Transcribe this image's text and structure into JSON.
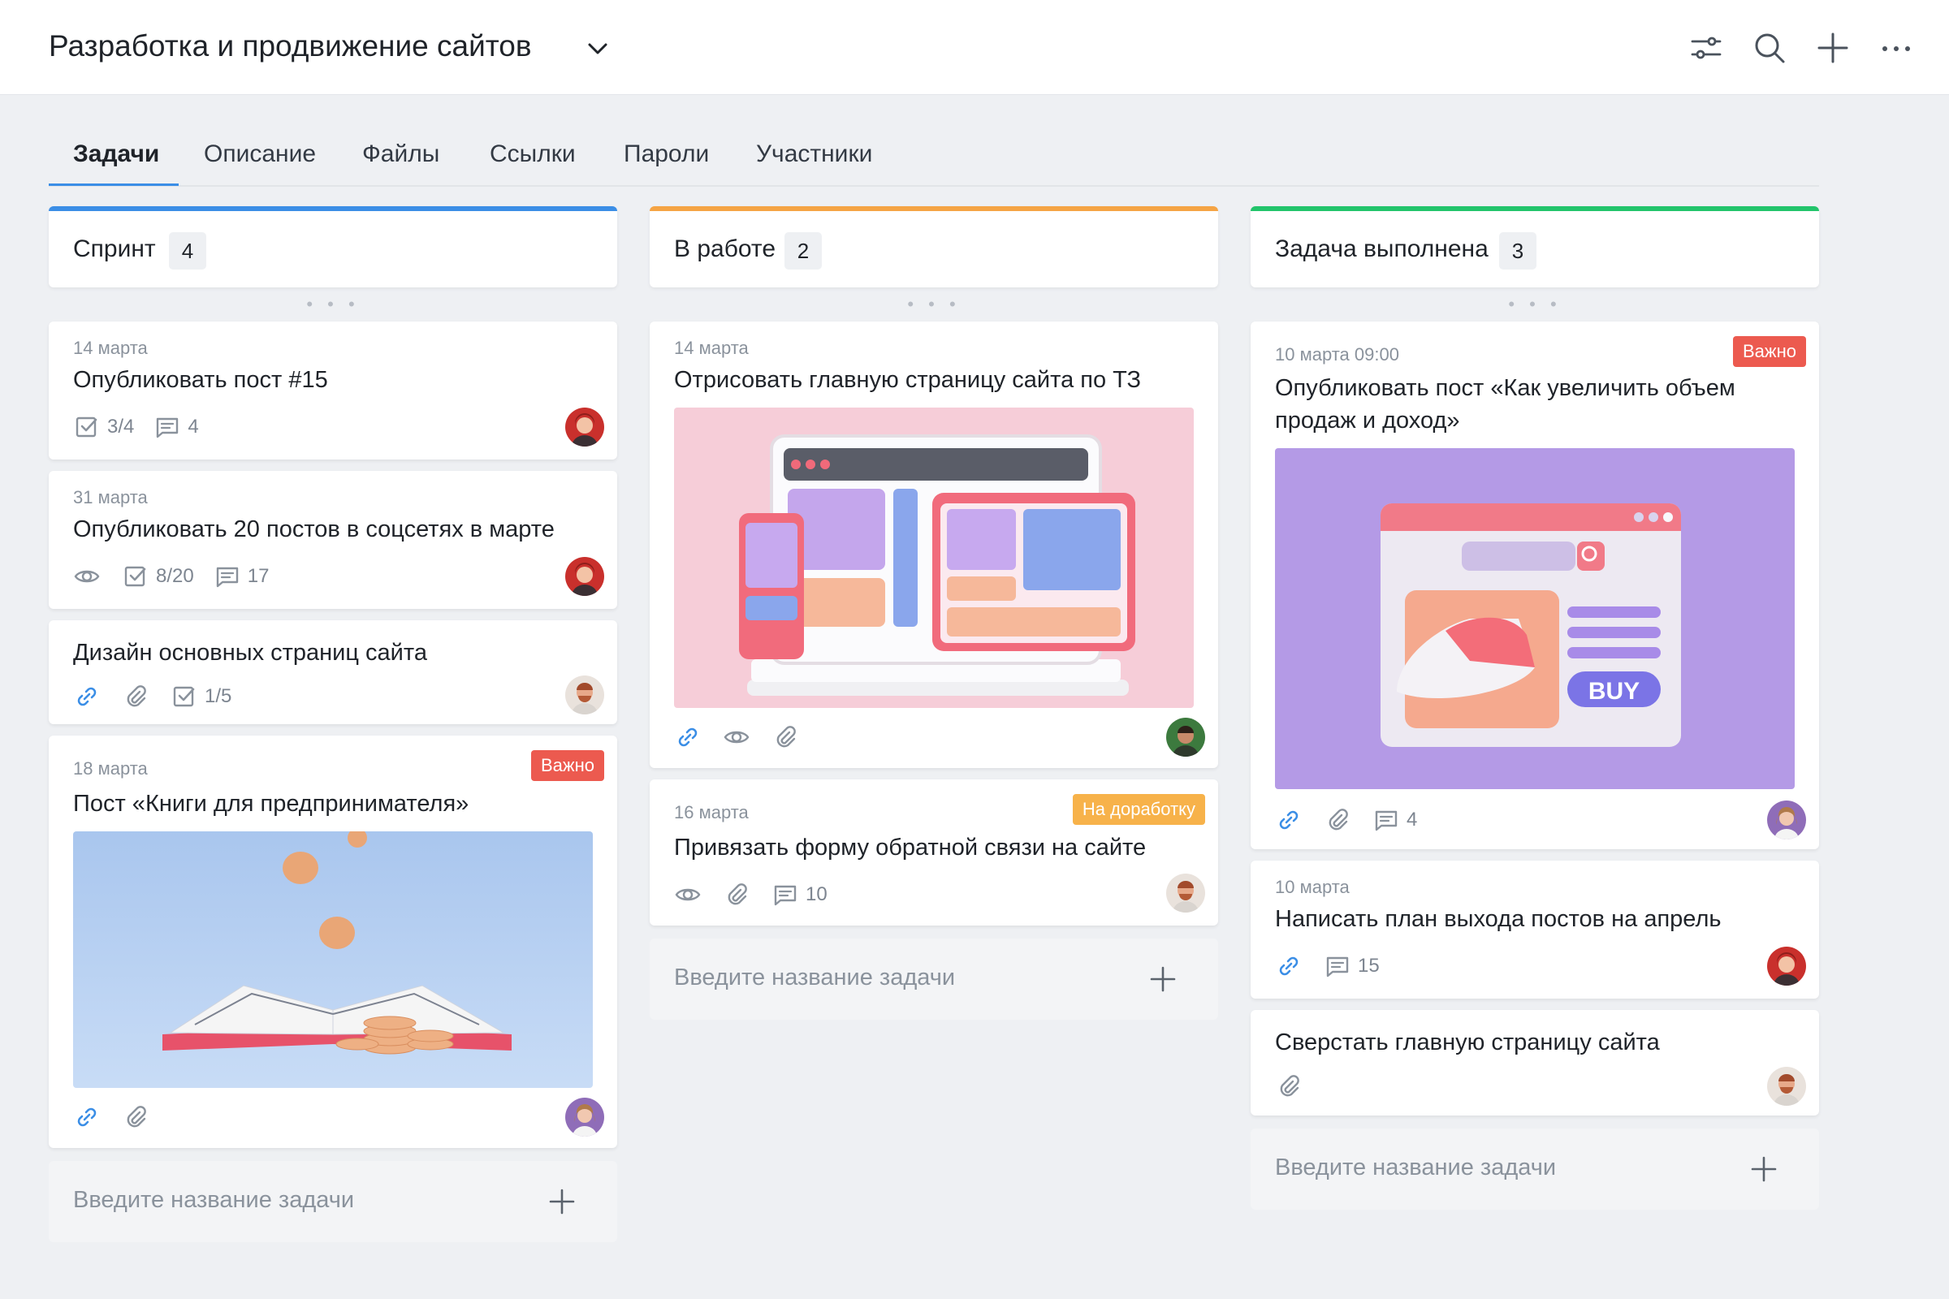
{
  "header": {
    "project_title": "Разработка и продвижение сайтов",
    "icons": [
      "filter-icon",
      "search-icon",
      "plus-icon",
      "more-icon"
    ]
  },
  "tabs": [
    {
      "label": "Задачи",
      "active": true
    },
    {
      "label": "Описание"
    },
    {
      "label": "Файлы"
    },
    {
      "label": "Ссылки"
    },
    {
      "label": "Пароли"
    },
    {
      "label": "Участники"
    }
  ],
  "colors": {
    "sprint": "#3b8ee6",
    "in_progress": "#f5a444",
    "done": "#22c46b",
    "badge_important": "#ec5a4f",
    "badge_rework": "#f7b24a"
  },
  "columns": [
    {
      "title": "Спринт",
      "count": "4",
      "cards": [
        {
          "date": "14 марта",
          "title": "Опубликовать пост #15",
          "checklist": "3/4",
          "comments": "4"
        },
        {
          "date": "31 марта",
          "title": "Опубликовать 20 постов в соцсетях в марте",
          "checklist": "8/20",
          "comments": "17"
        },
        {
          "title": "Дизайн основных страниц сайта",
          "checklist": "1/5"
        },
        {
          "date": "18 марта",
          "badge": "Важно",
          "title": "Пост «Книги для предпринимателя»"
        }
      ],
      "new_task_placeholder": "Введите название задачи"
    },
    {
      "title": "В работе",
      "count": "2",
      "cards": [
        {
          "date": "14 марта",
          "title": "Отрисовать главную страницу сайта по ТЗ"
        },
        {
          "date": "16 марта",
          "badge": "На доработку",
          "title": "Привязать форму обратной связи на сайте",
          "comments": "10"
        }
      ],
      "new_task_placeholder": "Введите название задачи"
    },
    {
      "title": "Задача выполнена",
      "count": "3",
      "cards": [
        {
          "date": "10 марта 09:00",
          "badge": "Важно",
          "title": "Опубликовать пост «Как увеличить объем продаж и доход»",
          "comments": "4",
          "image_text": "BUY"
        },
        {
          "date": "10 марта",
          "title": "Написать план выхода постов на апрель",
          "comments": "15"
        },
        {
          "title": "Сверстать главную страницу сайта"
        }
      ],
      "new_task_placeholder": "Введите название задачи"
    }
  ]
}
